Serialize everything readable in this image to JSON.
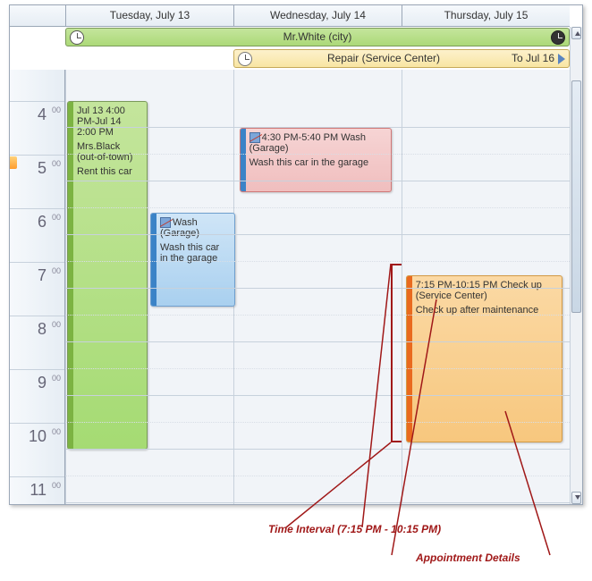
{
  "header": {
    "days": [
      "Tuesday, July 13",
      "Wednesday, July 14",
      "Thursday, July 15"
    ]
  },
  "allDay": {
    "bar1": {
      "label": "Mr.White (city)"
    },
    "bar2": {
      "label": "Repair (Service Center)",
      "to": "To Jul 16"
    }
  },
  "hours": [
    {
      "h": "4",
      "m": "00"
    },
    {
      "h": "5",
      "m": "00"
    },
    {
      "h": "6",
      "m": "00"
    },
    {
      "h": "7",
      "m": "00"
    },
    {
      "h": "8",
      "m": "00"
    },
    {
      "h": "9",
      "m": "00"
    },
    {
      "h": "10",
      "m": "00"
    },
    {
      "h": "11",
      "m": "00"
    }
  ],
  "appts": {
    "rent": {
      "time": "Jul 13 4:00 PM-Jul 14 2:00 PM",
      "who": "Mrs.Black (out-of-town)",
      "body": "Rent this car"
    },
    "wash1": {
      "title": "Wash (Garage)",
      "body": "Wash this car in the garage"
    },
    "wash2": {
      "title": "4:30 PM-5:40 PM Wash (Garage)",
      "body": "Wash this car in the garage"
    },
    "checkup": {
      "title": "7:15 PM-10:15 PM Check up (Service Center)",
      "body": "Check up after maintenance"
    }
  },
  "annotations": {
    "interval": "Time Interval (7:15 PM - 10:15 PM)",
    "details": "Appointment Details"
  }
}
